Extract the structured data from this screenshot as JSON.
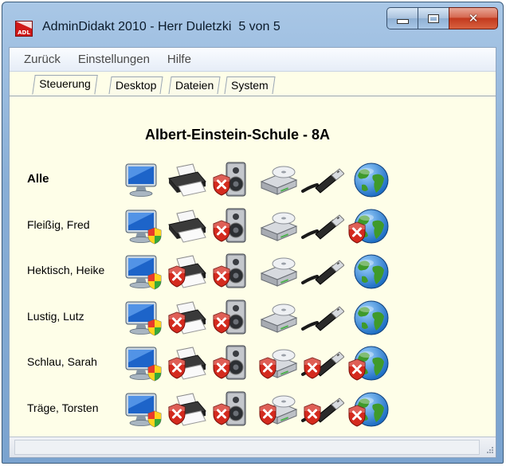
{
  "window": {
    "title": "AdminDidakt 2010 - Herr Duletzki  5 von 5",
    "app_icon_text": "ADL"
  },
  "menu": [
    "Zurück",
    "Einstellungen",
    "Hilfe"
  ],
  "tabs": [
    {
      "label": "Steuerung",
      "active": true
    },
    {
      "label": "Desktop",
      "active": false
    },
    {
      "label": "Dateien",
      "active": false
    },
    {
      "label": "System",
      "active": false
    }
  ],
  "school_heading": "Albert-Einstein-Schule - 8A",
  "device_icons": [
    "monitor-icon",
    "printer-icon",
    "speaker-icon",
    "drive-icon",
    "usb-icon",
    "internet-globe-icon"
  ],
  "rows": [
    {
      "label": "Alle",
      "bold": true,
      "monitor": "normal",
      "printer": "allowed",
      "speaker": "blocked",
      "drive": "allowed",
      "usb": "allowed",
      "internet": "allowed"
    },
    {
      "label": "Fleißig, Fred",
      "bold": false,
      "monitor": "shield",
      "printer": "allowed",
      "speaker": "blocked",
      "drive": "allowed",
      "usb": "allowed",
      "internet": "blocked"
    },
    {
      "label": "Hektisch, Heike",
      "bold": false,
      "monitor": "shield",
      "printer": "blocked",
      "speaker": "blocked",
      "drive": "allowed",
      "usb": "allowed",
      "internet": "allowed"
    },
    {
      "label": "Lustig, Lutz",
      "bold": false,
      "monitor": "shield",
      "printer": "blocked",
      "speaker": "blocked",
      "drive": "allowed",
      "usb": "allowed",
      "internet": "allowed"
    },
    {
      "label": "Schlau, Sarah",
      "bold": false,
      "monitor": "shield",
      "printer": "blocked",
      "speaker": "blocked",
      "drive": "blocked",
      "usb": "blocked",
      "internet": "blocked"
    },
    {
      "label": "Träge, Torsten",
      "bold": false,
      "monitor": "shield",
      "printer": "blocked",
      "speaker": "blocked",
      "drive": "blocked",
      "usb": "blocked",
      "internet": "blocked"
    }
  ],
  "colors": {
    "client_bg": "#fefee8",
    "block_red": "#d42a1e",
    "globe_blue": "#1f6fc4",
    "globe_green": "#3f9a2b"
  }
}
